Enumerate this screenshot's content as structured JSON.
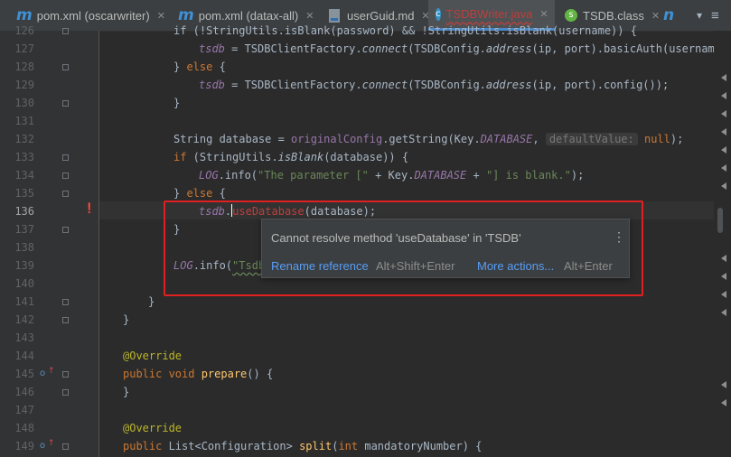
{
  "tabs": [
    {
      "icon": "m",
      "label": "pom.xml (oscarwriter)"
    },
    {
      "icon": "m",
      "label": "pom.xml (datax-all)"
    },
    {
      "icon": "md",
      "label": "userGuid.md"
    },
    {
      "icon": "c",
      "label": "TSDBWriter.java"
    },
    {
      "icon": "s",
      "label": "TSDB.class"
    },
    {
      "icon": "m",
      "label": "n"
    }
  ],
  "tabs_overflow": "≡",
  "line_numbers": [
    "126",
    "127",
    "128",
    "129",
    "130",
    "131",
    "132",
    "133",
    "134",
    "135",
    "136",
    "137",
    "138",
    "139",
    "140",
    "141",
    "142",
    "143",
    "144",
    "145",
    "146",
    "147",
    "148",
    "149"
  ],
  "current_line": "136",
  "code": {
    "l126": "if (!StringUtils.isBlank(password) && !StringUtils.isBlank(username)) {",
    "l127a": "tsdb",
    "l127b": " = TSDBClientFactory.",
    "l127c": "connect",
    "l127d": "(TSDBConfig.",
    "l127e": "address",
    "l127f": "(ip, port).basicAuth(username, p",
    "l128a": "} ",
    "l128b": "else",
    "l128c": " {",
    "l129a": "tsdb",
    "l129b": " = TSDBClientFactory.",
    "l129c": "connect",
    "l129d": "(TSDBConfig.",
    "l129e": "address",
    "l129f": "(ip, port).config());",
    "l130": "}",
    "l132a": "String database = ",
    "l132b": "originalConfig",
    "l132c": ".getString(Key.",
    "l132d": "DATABASE",
    "l132e": ", ",
    "l132hint": "defaultValue:",
    "l132f": " ",
    "l132g": "null",
    "l132h": ");",
    "l133a": "if",
    "l133b": " (StringUtils.",
    "l133c": "isBlank",
    "l133d": "(database)) {",
    "l134a": "LOG",
    "l134b": ".info(",
    "l134c": "\"The parameter [\"",
    "l134d": " + Key.",
    "l134e": "DATABASE",
    "l134f": " + ",
    "l134g": "\"] is blank.\"",
    "l134h": ");",
    "l135a": "} ",
    "l135b": "else",
    "l135c": " {",
    "l136a": "tsdb",
    "l136b": ".",
    "l136c": "useDatabase",
    "l136d": "(database);",
    "l137": "}",
    "l139a": "LOG",
    "l139b": ".info(",
    "l139c": "\"Tsdb",
    "l141": "}",
    "l142": "}",
    "l144": "@Override",
    "l145a": "public void ",
    "l145b": "prepare",
    "l145c": "() {",
    "l146": "}",
    "l148": "@Override",
    "l149a": "public ",
    "l149b": "List<Configuration> ",
    "l149c": "split",
    "l149d": "(",
    "l149e": "int ",
    "l149f": "mandatoryNumber) {"
  },
  "popup": {
    "message": "Cannot resolve method 'useDatabase' in 'TSDB'",
    "action1": "Rename reference",
    "shortcut1": "Alt+Shift+Enter",
    "action2": "More actions...",
    "shortcut2": "Alt+Enter",
    "menu_icon": "⋮"
  },
  "colors": {
    "keyword": "#cc7832",
    "field": "#9876aa",
    "string": "#6a8759",
    "error": "#bc3f3c",
    "annotation": "#bbb529",
    "link": "#589df6",
    "highlight_box": "#e02020"
  }
}
